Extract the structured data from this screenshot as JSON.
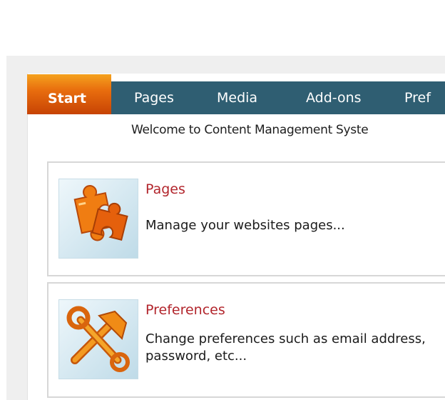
{
  "nav": {
    "tabs": [
      {
        "label": "Start"
      },
      {
        "label": "Pages"
      },
      {
        "label": "Media"
      },
      {
        "label": "Add-ons"
      },
      {
        "label": "Pref"
      }
    ]
  },
  "welcome_text": "Welcome to Content Management Syste",
  "cards": [
    {
      "title": "Pages",
      "description": "Manage your websites pages...",
      "icon": "puzzle-icon"
    },
    {
      "title": "Preferences",
      "description": "Change preferences such as email address, password, etc...",
      "icon": "tools-icon"
    }
  ],
  "colors": {
    "nav_bg": "#2f5e72",
    "active_tab": "#e86d0e",
    "card_title": "#b2252c"
  }
}
